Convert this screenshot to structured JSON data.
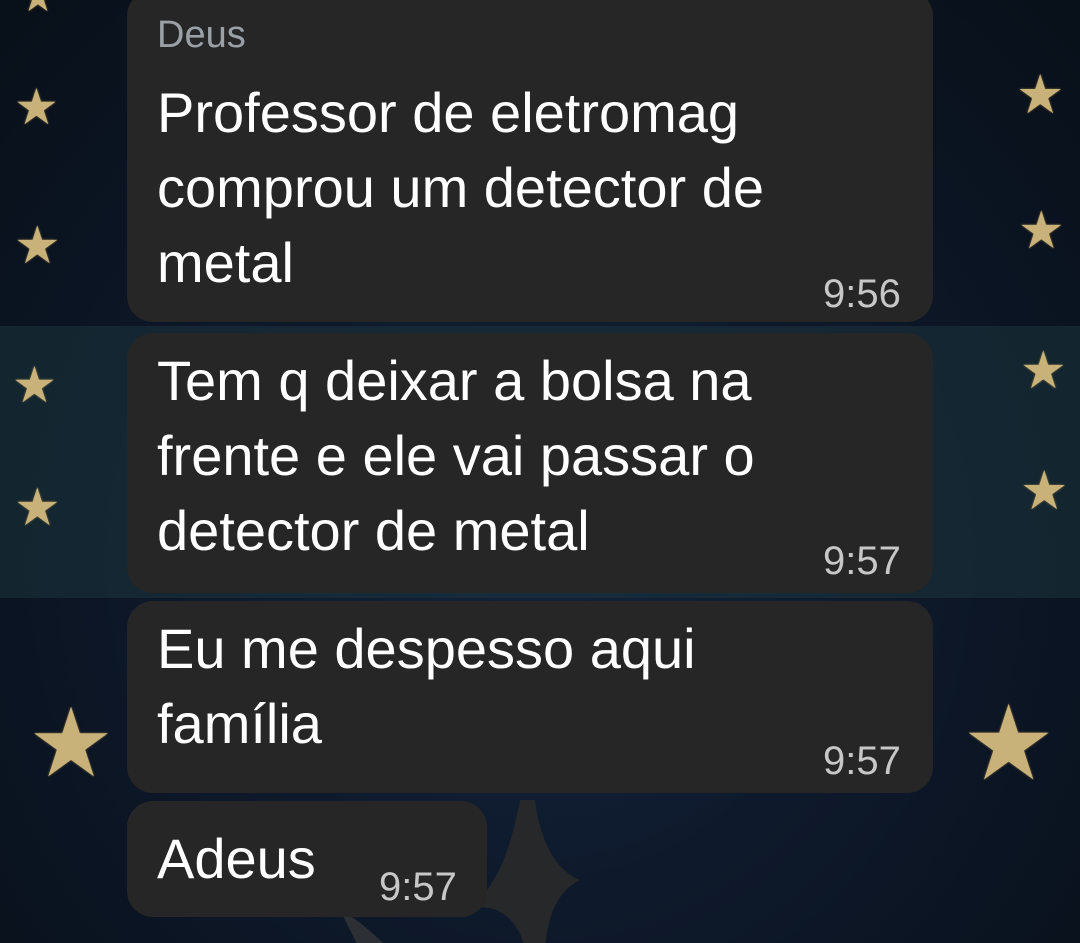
{
  "chat": {
    "messages": [
      {
        "sender": "Deus",
        "text": "Professor de eletromag\ncomprou um detector de\nmetal",
        "time": "9:56"
      },
      {
        "text": "Tem q deixar a bolsa na\nfrente e ele vai passar o\ndetector de metal",
        "time": "9:57"
      },
      {
        "text": "Eu me despesso aqui\nfamília",
        "time": "9:57"
      },
      {
        "text": "Adeus",
        "time": "9:57"
      }
    ]
  },
  "colors": {
    "bubble": "#262626",
    "wallpaper": "#0d1726",
    "star": "#c8b27a",
    "sender": "#9aa0a6"
  },
  "wallpaper": {
    "decor_icon": "gold-star-icon"
  }
}
